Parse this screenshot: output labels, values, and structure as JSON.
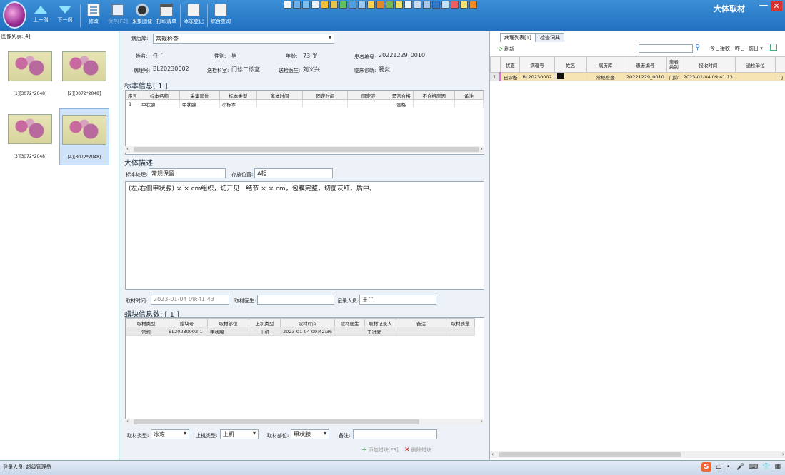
{
  "toolbar": {
    "prev": "上一例",
    "next": "下一例",
    "edit": "修改",
    "save": "保存[F2]",
    "capture": "采集图像",
    "print": "打印清单",
    "frozen_reg": "冰冻登记",
    "combined_query": "综合查询"
  },
  "app_title": "大体取材",
  "window": {
    "minimize": "—",
    "close": "✕"
  },
  "left_panel": {
    "title": "图像列表:[4]",
    "images": [
      {
        "label": "[1][3072*2048]"
      },
      {
        "label": "[2][3072*2048]"
      },
      {
        "label": "[3][3072*2048]"
      },
      {
        "label": "[4][3072*2048]"
      }
    ]
  },
  "form": {
    "library_label": "病历库:",
    "library_value": "常规检查",
    "name_label": "姓名:",
    "name_value": "任 ˊ",
    "gender_label": "性别:",
    "gender_value": "男",
    "age_label": "年龄:",
    "age_value": "73 岁",
    "patient_no_label": "患者编号:",
    "patient_no_value": "20221229_0010",
    "pathology_no_label": "病理号:",
    "pathology_no_value": "BL20230002",
    "dept_label": "送检科室:",
    "dept_value": "门诊二诊室",
    "doctor_label": "送检医生:",
    "doctor_value": "刘义兴",
    "diagnosis_label": "临床诊断:",
    "diagnosis_value": "肠炎"
  },
  "specimen": {
    "title": "标本信息[ 1 ]",
    "columns": [
      "序号",
      "标本名称",
      "采集部位",
      "标本类型",
      "离体时间",
      "固定时间",
      "固定液",
      "是否合格",
      "不合格原因",
      "备注"
    ],
    "rows": [
      [
        "1",
        "甲状腺",
        "甲状腺",
        "小标本",
        "",
        "",
        "",
        "合格",
        "",
        ""
      ]
    ]
  },
  "gross": {
    "title": "大体描述",
    "handling_label": "标本处理:",
    "handling_value": "常规保留",
    "storage_label": "存放位置:",
    "storage_value": "A柜",
    "description": "(左/右侧甲状腺) × × cm组织，切开见一结节 × × cm，包膜完整，切面灰红，质中。"
  },
  "sampling": {
    "time_label": "取材时间:",
    "time_value": "2023-01-04  09:41:43",
    "doctor_label": "取材医生:",
    "doctor_value": "",
    "recorder_label": "记录人员:",
    "recorder_value": "王ˊˊ"
  },
  "blocks": {
    "title": "蜡块信息数: [ 1 ]",
    "columns": [
      "取材类型",
      "蜡块号",
      "取材部位",
      "上机类型",
      "取材时间",
      "取材医生",
      "取材记录人",
      "备注",
      "取材质量"
    ],
    "rows": [
      [
        "常规",
        "BL20230002-1",
        "甲状腺",
        "上机",
        "2023-01-04 09:42:36",
        "",
        "王进武",
        "",
        ""
      ]
    ]
  },
  "bottom": {
    "type_label": "取材类型:",
    "type_value": "冰冻",
    "machine_label": "上机类型:",
    "machine_value": "上机",
    "part_label": "取材部位:",
    "part_value": "甲状腺",
    "note_label": "备注:",
    "note_value": "",
    "add_block": "添加蜡块[F3]",
    "delete_block": "删除蜡块"
  },
  "right_panel": {
    "tabs": [
      "病理列表[1]",
      "检查词典"
    ],
    "refresh": "刷新",
    "search_value": "",
    "today": "今日接收",
    "yesterday": "昨日",
    "before": "前日",
    "columns": [
      "",
      "状态",
      "病理号",
      "姓名",
      "病历库",
      "患者编号",
      "患者类别",
      "接收时间",
      "送检单位",
      ""
    ],
    "rows": [
      [
        "1",
        "已诊断",
        "BL20230002",
        "",
        "常规检查",
        "20221229_0010",
        "门诊",
        "2023-01-04 09:41:13",
        "",
        "门"
      ]
    ]
  },
  "status_bar": {
    "user": "登录人员: 超级管理员"
  },
  "ime": {
    "logo": "S",
    "lang": "中"
  }
}
